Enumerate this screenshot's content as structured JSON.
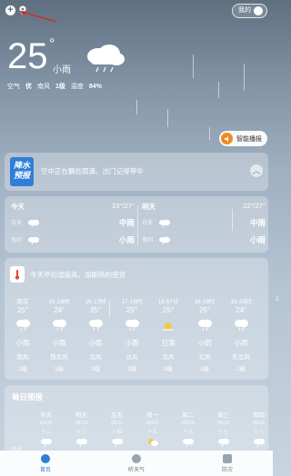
{
  "header": {
    "mine_label": "我的"
  },
  "current": {
    "temp": "25",
    "unit": "°",
    "condition": "小雨",
    "air_label": "空气",
    "air_value": "优",
    "wind_dir": "南风",
    "wind_level": "1级",
    "humidity_label": "湿度",
    "humidity_value": "84%"
  },
  "broadcast_label": "智能播报",
  "alert": {
    "badge_line1": "降水",
    "badge_line2": "预报",
    "text": "空中正在飘些雨滴，出门记得带伞"
  },
  "today": {
    "name": "今天",
    "range": "23°/27°",
    "day_label": "白天",
    "day_cond": "中雨",
    "night_label": "夜间",
    "night_cond": "小雨"
  },
  "tomorrow": {
    "name": "明天",
    "range": "22°/27°",
    "day_label": "白天",
    "day_cond": "中雨",
    "night_label": "夜间",
    "night_cond": "小雨"
  },
  "tip": "今天平均湿度高，加剧热的感觉",
  "hourly": [
    {
      "time": "现在",
      "temp": "25°",
      "cond": "小雨",
      "wind": "南风",
      "level": "1级",
      "icon": "cloud-rain-icon"
    },
    {
      "time": "15-16时",
      "temp": "24°",
      "cond": "小雨",
      "wind": "西北风",
      "level": "1级",
      "icon": "cloud-rain-icon"
    },
    {
      "time": "16-17时",
      "temp": "25°",
      "cond": "小雨",
      "wind": "北风",
      "level": "2级",
      "icon": "cloud-rain-icon"
    },
    {
      "time": "17-18时",
      "temp": "25°",
      "cond": "小雨",
      "wind": "北风",
      "level": "2级",
      "icon": "cloud-rain-icon"
    },
    {
      "time": "18:57分",
      "temp": "25°",
      "cond": "日落",
      "wind": "北风",
      "level": "2级",
      "icon": "sunset-icon"
    },
    {
      "time": "18-19时",
      "temp": "25°",
      "cond": "小雨",
      "wind": "北风",
      "level": "1级",
      "icon": "cloud-rain-icon"
    },
    {
      "time": "19-20时",
      "temp": "24°",
      "cond": "小雨",
      "wind": "东北风",
      "level": "1级",
      "icon": "cloud-rain-icon"
    },
    {
      "time": "2",
      "temp": "",
      "cond": "",
      "wind": "",
      "level": "",
      "icon": ""
    }
  ],
  "daily": {
    "title": "每日预报",
    "daytime_label": "白天",
    "days": [
      {
        "name": "今天",
        "date": "05/09",
        "lunar": "十二"
      },
      {
        "name": "明天",
        "date": "05/10",
        "lunar": "十三"
      },
      {
        "name": "后天",
        "date": "05/11",
        "lunar": "十四"
      },
      {
        "name": "周一",
        "date": "05/12",
        "lunar": "十五"
      },
      {
        "name": "周二",
        "date": "05/13",
        "lunar": "十六"
      },
      {
        "name": "周三",
        "date": "05/14",
        "lunar": "十七"
      },
      {
        "name": "周四",
        "date": "05/15",
        "lunar": "十八"
      }
    ]
  },
  "nav": [
    {
      "label": "首页",
      "icon": "home-icon"
    },
    {
      "label": "听天气",
      "icon": "listen-icon"
    },
    {
      "label": "防灾",
      "icon": "shield-icon"
    }
  ]
}
